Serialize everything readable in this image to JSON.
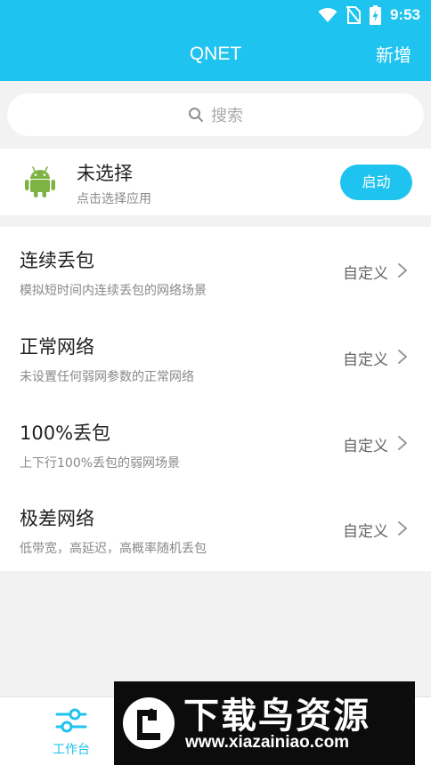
{
  "status_bar": {
    "time": "9:53",
    "icons": [
      "wifi-icon",
      "no-sim-icon",
      "battery-charging-icon"
    ]
  },
  "app_bar": {
    "title": "QNET",
    "add_label": "新增"
  },
  "search": {
    "placeholder": "搜索",
    "icon": "search-icon"
  },
  "app_selector": {
    "icon": "android-icon",
    "name": "未选择",
    "hint": "点击选择应用",
    "start_label": "启动"
  },
  "profiles": [
    {
      "title": "连续丢包",
      "description": "模拟短时间内连续丢包的网络场景",
      "action_label": "自定义"
    },
    {
      "title": "正常网络",
      "description": "未设置任何弱网参数的正常网络",
      "action_label": "自定义"
    },
    {
      "title": "100%丢包",
      "description": "上下行100%丢包的弱网场景",
      "action_label": "自定义"
    },
    {
      "title": "极差网络",
      "description": "低带宽，高延迟，高概率随机丢包",
      "action_label": "自定义"
    }
  ],
  "bottom_nav": {
    "tabs": [
      {
        "label": "工作台",
        "icon": "sliders-icon",
        "active": true
      }
    ]
  },
  "watermark": {
    "title": "下载鸟资源",
    "url": "www.xiazainiao.com"
  },
  "colors": {
    "accent": "#1fc3ef",
    "android_green": "#7cb342",
    "background": "#f2f2f2"
  }
}
